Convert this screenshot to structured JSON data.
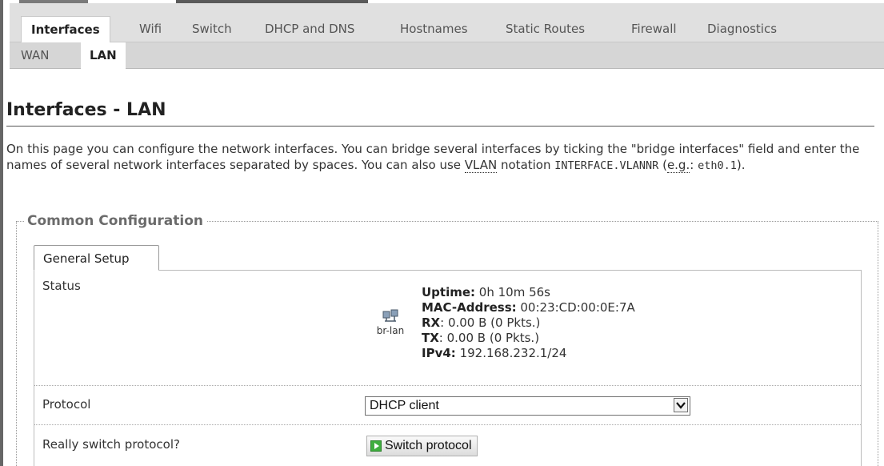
{
  "main_tabs": [
    {
      "label": "Interfaces",
      "active": true
    },
    {
      "label": "Wifi",
      "active": false
    },
    {
      "label": "Switch",
      "active": false
    },
    {
      "label": "DHCP and DNS",
      "active": false
    },
    {
      "label": "Hostnames",
      "active": false
    },
    {
      "label": "Static Routes",
      "active": false
    },
    {
      "label": "Firewall",
      "active": false
    },
    {
      "label": "Diagnostics",
      "active": false
    }
  ],
  "sub_tabs": [
    {
      "label": "WAN",
      "active": false
    },
    {
      "label": "LAN",
      "active": true
    }
  ],
  "page": {
    "title": "Interfaces - LAN",
    "description_part1": "On this page you can configure the network interfaces. You can bridge several interfaces by ticking the \"bridge interfaces\" field and enter the names of several network interfaces separated by spaces. You can also use ",
    "description_vlan": "VLAN",
    "description_part2": " notation ",
    "description_code1": "INTERFACE.VLANNR",
    "description_part3": " (",
    "description_eg": "e.g.",
    "description_part4": ": ",
    "description_code2": "eth0.1",
    "description_part5": ")."
  },
  "section": {
    "legend": "Common Configuration",
    "tab_label": "General Setup"
  },
  "status": {
    "label": "Status",
    "device": "br-lan",
    "uptime_label": "Uptime:",
    "uptime_value": " 0h 10m 56s",
    "mac_label": "MAC-Address:",
    "mac_value": " 00:23:CD:00:0E:7A",
    "rx_label": "RX",
    "rx_value": ": 0.00 B (0 Pkts.)",
    "tx_label": "TX",
    "tx_value": ": 0.00 B (0 Pkts.)",
    "ipv4_label": "IPv4:",
    "ipv4_value": " 192.168.232.1/24"
  },
  "protocol": {
    "label": "Protocol",
    "selected": "DHCP client"
  },
  "switch_protocol": {
    "label": "Really switch protocol?",
    "button_label": "Switch protocol"
  },
  "icons": {
    "network_device": "network-bridge-icon",
    "dropdown": "chevron-down-icon",
    "apply": "apply-icon"
  },
  "colors": {
    "tabbar_bg": "#e0e0e0",
    "subtabbar_bg": "#d6d6d6",
    "apply_green": "#3fae3f"
  }
}
